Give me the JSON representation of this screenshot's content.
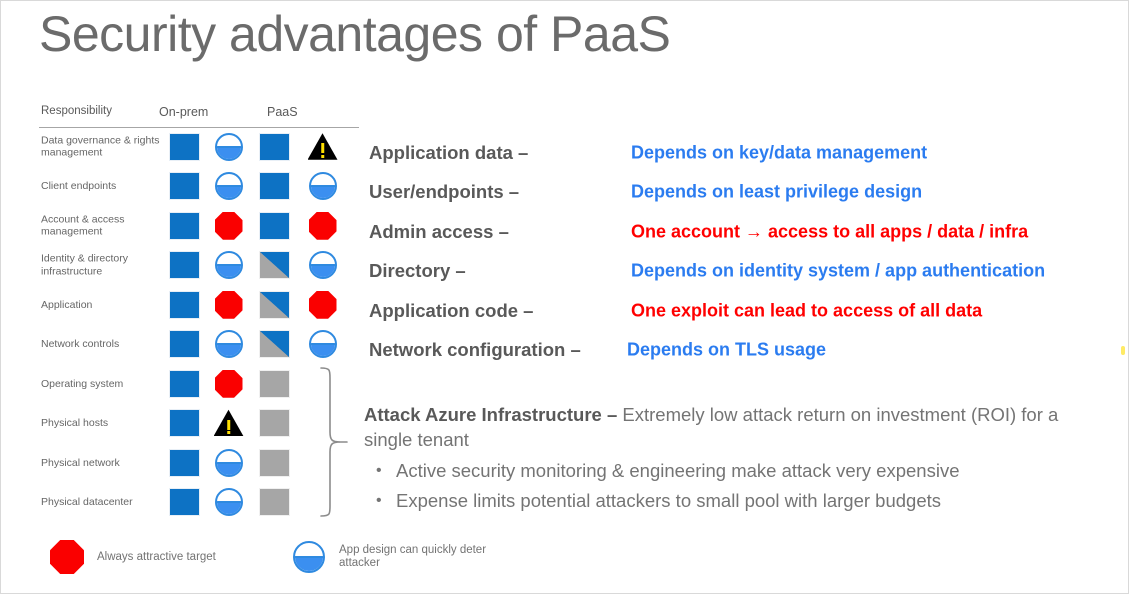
{
  "slide": {
    "title": "Security advantages of PaaS"
  },
  "matrix": {
    "headers": {
      "responsibility": "Responsibility",
      "on_prem": "On-prem",
      "paas": "PaaS"
    },
    "rows": [
      {
        "label": "Data governance & rights management",
        "onprem_square": "blue",
        "onprem_icon": "half-circle",
        "paas_square": "blue",
        "paas_icon": "warning-triangle"
      },
      {
        "label": "Client endpoints",
        "onprem_square": "blue",
        "onprem_icon": "half-circle",
        "paas_square": "blue",
        "paas_icon": "half-circle"
      },
      {
        "label": "Account & access management",
        "onprem_square": "blue",
        "onprem_icon": "octagon",
        "paas_square": "blue",
        "paas_icon": "octagon"
      },
      {
        "label": "Identity & directory infrastructure",
        "onprem_square": "blue",
        "onprem_icon": "half-circle",
        "paas_square": "split",
        "paas_icon": "half-circle"
      },
      {
        "label": "Application",
        "onprem_square": "blue",
        "onprem_icon": "octagon",
        "paas_square": "split",
        "paas_icon": "octagon"
      },
      {
        "label": "Network controls",
        "onprem_square": "blue",
        "onprem_icon": "half-circle",
        "paas_square": "split",
        "paas_icon": "half-circle"
      },
      {
        "label": "Operating system",
        "onprem_square": "blue",
        "onprem_icon": "octagon",
        "paas_square": "gray",
        "paas_icon": "none"
      },
      {
        "label": "Physical hosts",
        "onprem_square": "blue",
        "onprem_icon": "warning-triangle",
        "paas_square": "gray",
        "paas_icon": "none"
      },
      {
        "label": "Physical network",
        "onprem_square": "blue",
        "onprem_icon": "half-circle",
        "paas_square": "gray",
        "paas_icon": "none"
      },
      {
        "label": "Physical datacenter",
        "onprem_square": "blue",
        "onprem_icon": "half-circle",
        "paas_square": "gray",
        "paas_icon": "none"
      }
    ]
  },
  "callouts": [
    {
      "term": "Application data –",
      "desc": "Depends on key/data management",
      "tone": "blue"
    },
    {
      "term": "User/endpoints –",
      "desc": "Depends on least privilege design",
      "tone": "blue"
    },
    {
      "term": "Admin access –",
      "desc": "One account → access to all apps / data / infra",
      "tone": "red"
    },
    {
      "term": "Directory –",
      "desc": "Depends on identity system / app authentication",
      "tone": "blue"
    },
    {
      "term": "Application code –",
      "desc": "One exploit can lead to access of all data",
      "tone": "red"
    },
    {
      "term": "Network configuration –",
      "desc": "Depends on TLS usage",
      "tone": "blue"
    }
  ],
  "attack": {
    "heading": "Attack Azure Infrastructure –",
    "lead": " Extremely low attack return on investment (ROI) for a single tenant",
    "bullets": [
      "Active security monitoring & engineering make attack very expensive",
      "Expense limits potential attackers to small pool with larger budgets"
    ]
  },
  "legend": [
    {
      "icon": "octagon",
      "text": "Always attractive target"
    },
    {
      "icon": "half-circle",
      "text": "App design can quickly deter attacker"
    }
  ],
  "colors": {
    "blue_square": "#0d72c4",
    "gray_square": "#a6a6a6",
    "red": "#ff0000",
    "link_blue": "#2b7cf0",
    "text_gray": "#595959"
  }
}
